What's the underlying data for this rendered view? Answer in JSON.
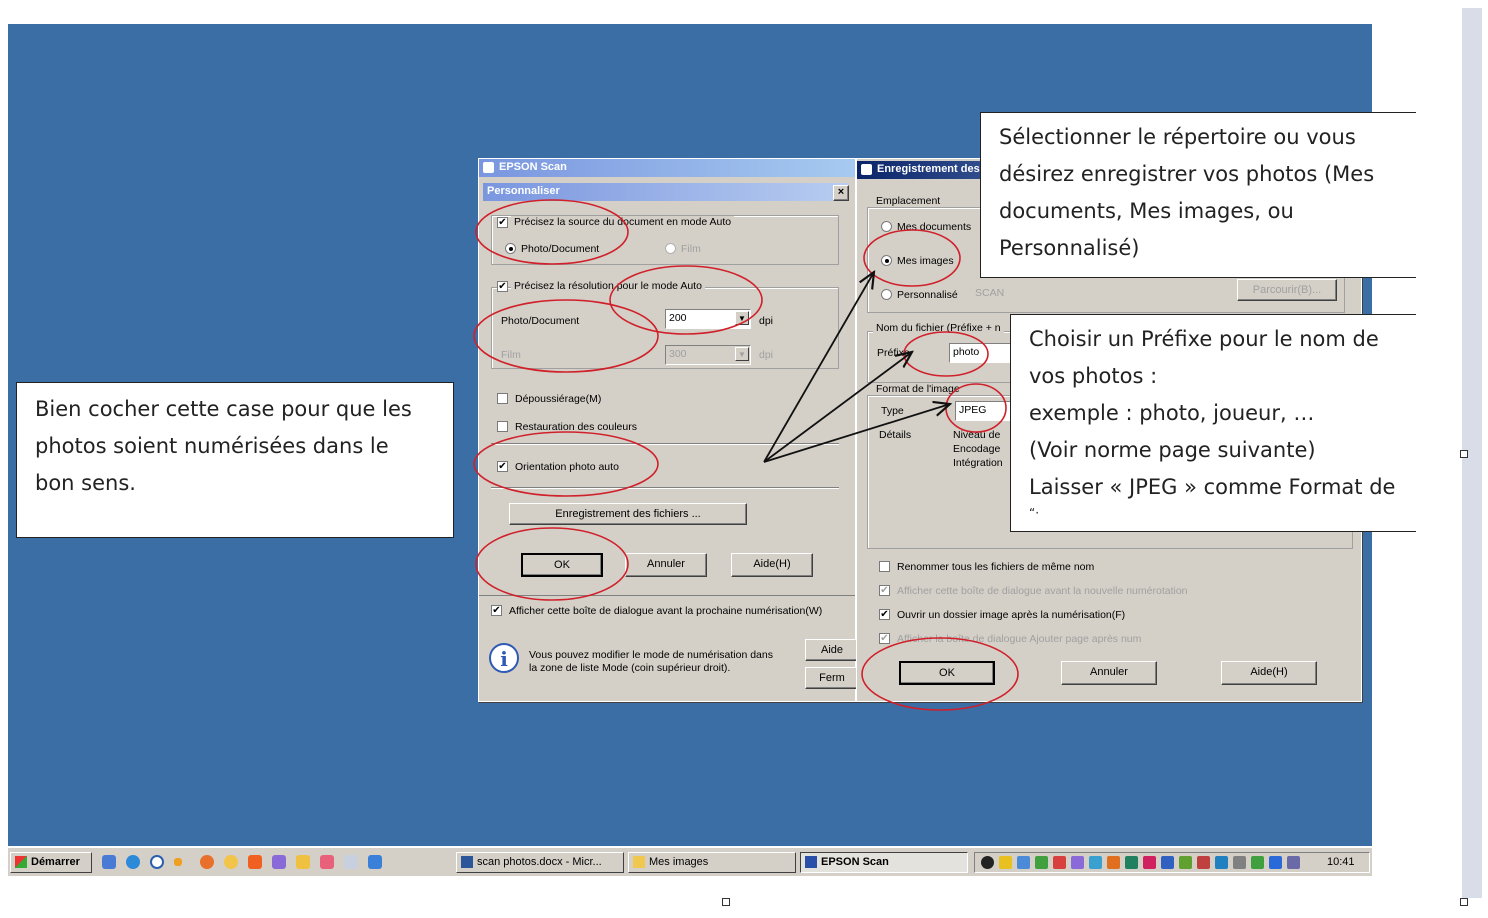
{
  "colors": {
    "desktop": "#3a6ea5",
    "annotation": "#d0202a",
    "title_active": "#0a246a"
  },
  "epson_window": {
    "title": "EPSON Scan",
    "dialog_title": "Personnaliser",
    "close_label": "×",
    "source_check_label": "Précisez la source du document en mode Auto",
    "radio_photo_document": "Photo/Document",
    "radio_film": "Film",
    "resolution_check_label": "Précisez la résolution pour le mode Auto",
    "photo_document_label": "Photo/Document",
    "photo_dpi_value": "200",
    "film_label": "Film",
    "film_dpi_value": "300",
    "dpi_unit": "dpi",
    "dust_label": "Dépoussiérage(M)",
    "color_restore_label": "Restauration des couleurs",
    "auto_orientation_label": "Orientation photo auto",
    "file_save_button": "Enregistrement des fichiers ...",
    "ok_button": "OK",
    "cancel_button": "Annuler",
    "help_button": "Aide(H)",
    "show_dialog_check": "Afficher cette boîte de dialogue avant la prochaine numérisation(W)",
    "info_text_1": "Vous pouvez modifier le mode de numérisation dans",
    "info_text_2": "la zone de liste Mode (coin supérieur droit).",
    "aide_button": "Aide",
    "fermer_button": "Ferm"
  },
  "save_window": {
    "title": "Enregistrement des fichiers",
    "location_group": "Emplacement",
    "radio_my_documents": "Mes documents",
    "radio_my_images": "Mes images",
    "radio_custom": "Personnalisé",
    "custom_path": "SCAN",
    "browse_button": "Parcourir(B)...",
    "filename_group": "Nom du fichier (Préfixe + n",
    "prefix_label": "Préfixe",
    "prefix_value": "photo",
    "image_format_group": "Format de l'image",
    "type_label": "Type",
    "type_value": "JPEG",
    "details_label": "Détails",
    "details_line_1": "Niveau de",
    "details_line_2": "Encodage",
    "details_line_3": "Intégration",
    "rename_check": "Renommer tous les fichiers de même nom",
    "show_before_check": "Afficher cette boîte de dialogue avant la nouvelle numérotation",
    "open_folder_check": "Ouvrir un dossier image après la numérisation(F)",
    "add_page_check": "Afficher la boîte de dialogue Ajouter page après num",
    "ok_button": "OK",
    "cancel_button": "Annuler",
    "help_button": "Aide(H)"
  },
  "callouts": {
    "left": [
      "Bien cocher cette case pour que les",
      "photos soient numérisées dans le",
      "bon sens."
    ],
    "top_right": [
      "Sélectionner le répertoire ou vous",
      "désirez enregistrer vos photos (Mes",
      "documents, Mes images, ou",
      "Personnalisé)"
    ],
    "mid_right": [
      "Choisir un Préfixe pour le nom de",
      "vos photos :",
      "exemple : photo,  joueur, …",
      "(Voir norme page suivante)",
      "Laisser « JPEG » comme Format de",
      "“·"
    ]
  },
  "taskbar": {
    "start_label": "Démarrer",
    "tasks": [
      "scan photos.docx - Micr...",
      "Mes images",
      "EPSON Scan"
    ],
    "clock": "10:41"
  }
}
